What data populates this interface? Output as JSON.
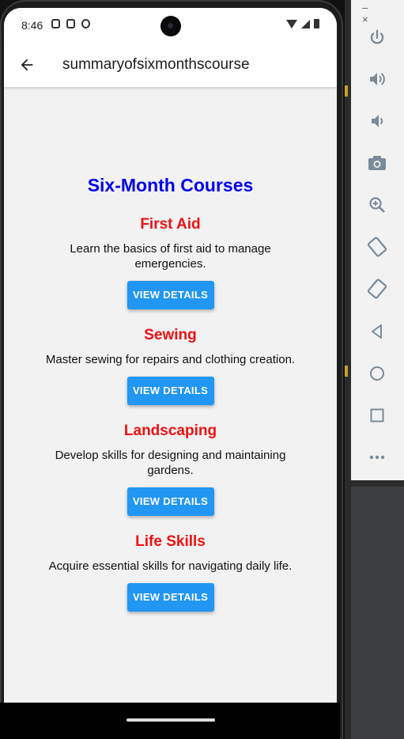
{
  "status": {
    "time": "8:46"
  },
  "appbar": {
    "title": "summaryofsixmonthscourse"
  },
  "page": {
    "heading": "Six-Month Courses",
    "courses": [
      {
        "name": "First Aid",
        "description": "Learn the basics of first aid to manage emergencies.",
        "button": "VIEW DETAILS"
      },
      {
        "name": "Sewing",
        "description": "Master sewing for repairs and clothing creation.",
        "button": "VIEW DETAILS"
      },
      {
        "name": "Landscaping",
        "description": "Develop skills for designing and maintaining gardens.",
        "button": "VIEW DETAILS"
      },
      {
        "name": "Life Skills",
        "description": "Acquire essential skills for navigating daily life.",
        "button": "VIEW DETAILS"
      }
    ]
  },
  "emulator_toolbar": {
    "window_controls": [
      "–",
      "×"
    ],
    "buttons": [
      "power-icon",
      "volume-up-icon",
      "volume-down-icon",
      "camera-icon",
      "zoom-icon",
      "rotate-left-icon",
      "rotate-right-icon",
      "back-icon",
      "home-icon",
      "overview-icon",
      "more-icon"
    ]
  },
  "colors": {
    "heading": "#0000ee",
    "course_title": "#ee1111",
    "button": "#2196f3",
    "background": "#f2f2f2"
  }
}
